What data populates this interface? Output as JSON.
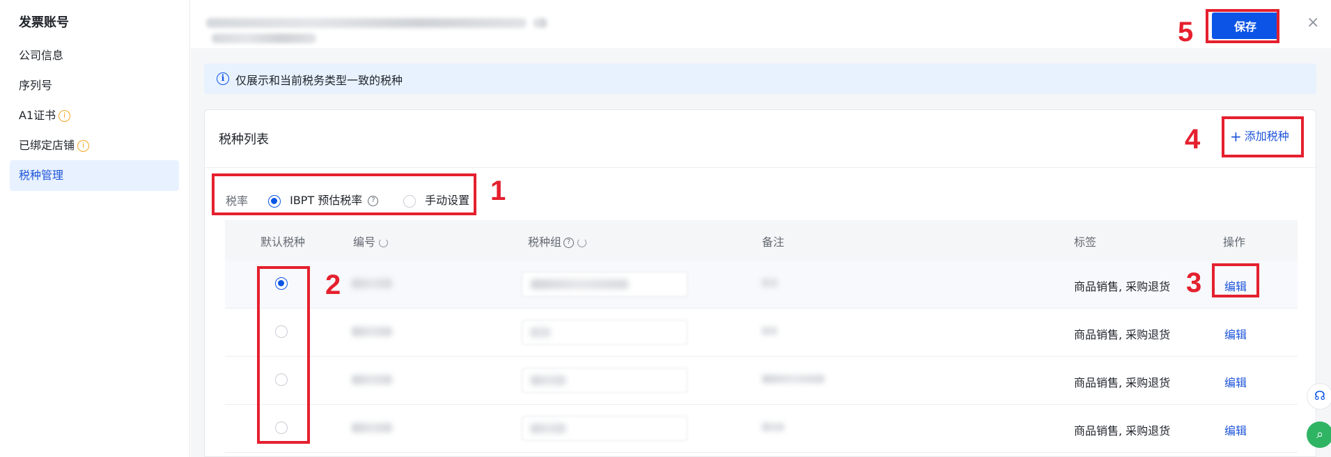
{
  "sidebar": {
    "title": "发票账号",
    "items": [
      {
        "label": "公司信息",
        "info": false,
        "active": false
      },
      {
        "label": "序列号",
        "info": false,
        "active": false
      },
      {
        "label": "A1证书",
        "info": true,
        "active": false
      },
      {
        "label": "已绑定店铺",
        "info": true,
        "active": false
      },
      {
        "label": "税种管理",
        "info": false,
        "active": true
      }
    ]
  },
  "header": {
    "save_label": "保存",
    "close_label": "×"
  },
  "banner": {
    "text": "仅展示和当前税务类型一致的税种"
  },
  "card": {
    "title": "税种列表",
    "add_label": "添加税种",
    "rate": {
      "label": "税率",
      "options": [
        {
          "label": "IBPT 预估税率",
          "selected": true
        },
        {
          "label": "手动设置",
          "selected": false
        }
      ]
    }
  },
  "table": {
    "columns": [
      "默认税种",
      "编号",
      "税种组",
      "备注",
      "标签",
      "操作"
    ],
    "rows": [
      {
        "default": true,
        "tag": "商品销售, 采购退货",
        "action": "编辑"
      },
      {
        "default": false,
        "tag": "商品销售, 采购退货",
        "action": "编辑"
      },
      {
        "default": false,
        "tag": "商品销售, 采购退货",
        "action": "编辑"
      },
      {
        "default": false,
        "tag": "商品销售, 采购退货",
        "action": "编辑"
      }
    ]
  },
  "annotations": {
    "color": "#e5202e",
    "labels": [
      "1",
      "2",
      "3",
      "4",
      "5"
    ]
  },
  "colors": {
    "primary": "#0b54e6",
    "link": "#1e55d8",
    "warning": "#f5a623",
    "annotation": "#e5202e"
  }
}
